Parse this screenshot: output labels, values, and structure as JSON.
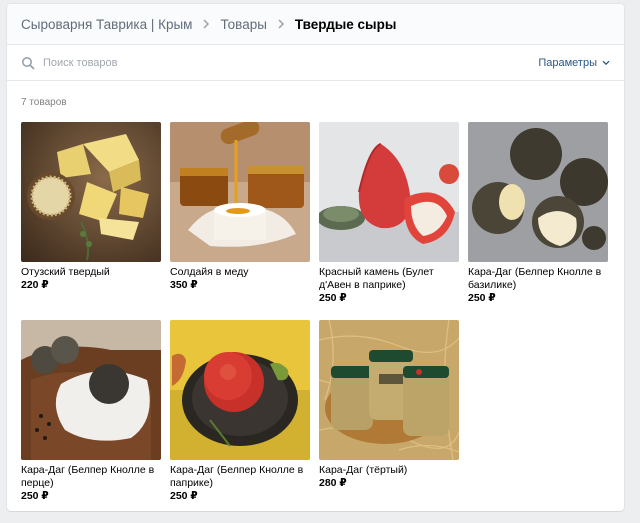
{
  "breadcrumbs": [
    {
      "label": "Сыроварня Таврика | Крым"
    },
    {
      "label": "Товары"
    },
    {
      "label": "Твердые сыры"
    }
  ],
  "search": {
    "placeholder": "Поиск товаров"
  },
  "params_label": "Параметры",
  "count_label": "7 товаров",
  "products": [
    {
      "name": "Отузский твердый",
      "price": "220 ₽"
    },
    {
      "name": "Солдайя в меду",
      "price": "350 ₽"
    },
    {
      "name": "Красный камень (Булет д'Авен в паприке)",
      "price": "250 ₽"
    },
    {
      "name": "Кара-Даг (Белпер Кнолле в базилике)",
      "price": "250 ₽"
    },
    {
      "name": "Кара-Даг (Белпер Кнолле в перце)",
      "price": "250 ₽"
    },
    {
      "name": "Кара-Даг (Белпер Кнолле в паприке)",
      "price": "250 ₽"
    },
    {
      "name": "Кара-Даг (тёртый)",
      "price": "280 ₽"
    }
  ]
}
